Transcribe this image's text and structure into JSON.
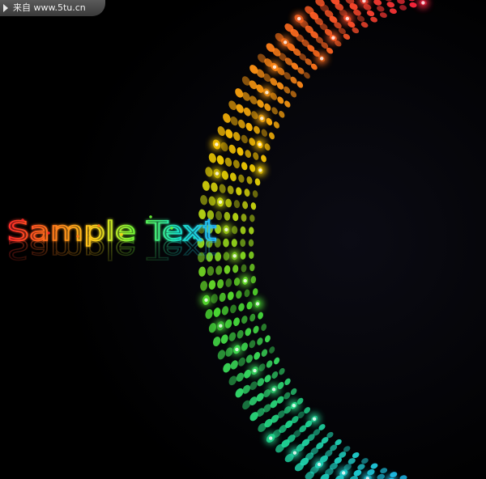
{
  "watermark": {
    "text": "来自 www.5tu.cn",
    "icon": "play-arrow-icon"
  },
  "headline": {
    "text": "Sample Text",
    "colors": [
      "#ff2a2a",
      "#ff7a1a",
      "#ffd21a",
      "#6cff3a",
      "#19e2c8",
      "#27b8ff"
    ]
  },
  "ring": {
    "colors": [
      "#ff2040",
      "#ff6a20",
      "#ffd000",
      "#4fe030",
      "#20d890",
      "#20c8ff"
    ]
  }
}
